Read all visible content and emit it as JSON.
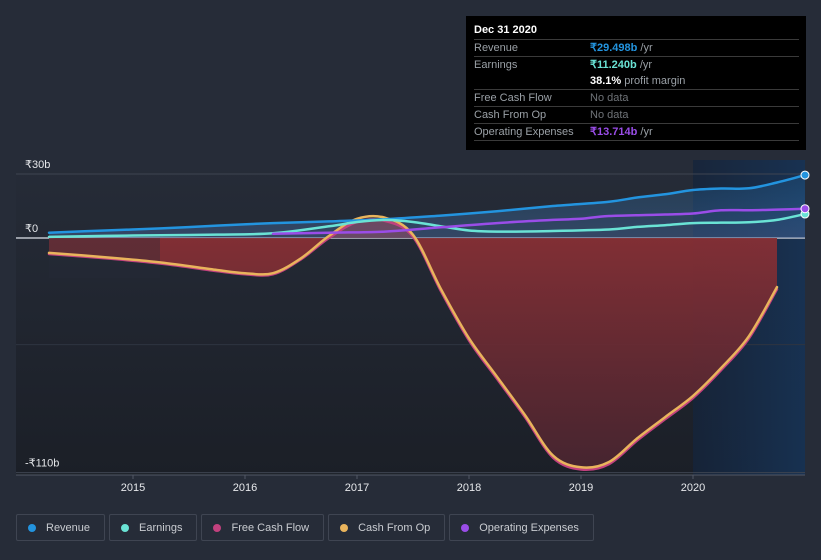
{
  "chart_data": {
    "type": "line",
    "title": "",
    "xlabel": "",
    "ylabel": "",
    "currency_symbol": "₹",
    "y_ticks": [
      {
        "value": 30,
        "label": "₹30b"
      },
      {
        "value": 0,
        "label": "₹0"
      },
      {
        "value": -110,
        "label": "-₹110b"
      }
    ],
    "x_ticks": [
      {
        "value": 2015,
        "label": "2015"
      },
      {
        "value": 2016,
        "label": "2016"
      },
      {
        "value": 2017,
        "label": "2017"
      },
      {
        "value": 2018,
        "label": "2018"
      },
      {
        "value": 2019,
        "label": "2019"
      },
      {
        "value": 2020,
        "label": "2020"
      }
    ],
    "xlim": [
      2014.25,
      2021.0
    ],
    "ylim": [
      -110,
      30
    ],
    "highlight_start": 2020.0,
    "series": [
      {
        "name": "Revenue",
        "key": "revenue",
        "color": "#2394df",
        "unit": "b",
        "x": [
          2014.25,
          2014.75,
          2015.25,
          2015.75,
          2016.25,
          2016.75,
          2017.25,
          2017.75,
          2018.25,
          2018.75,
          2019.25,
          2019.5,
          2019.75,
          2020.0,
          2020.25,
          2020.5,
          2020.75,
          2021.0
        ],
        "values": [
          2.5,
          3.5,
          4.5,
          5.8,
          7.0,
          7.8,
          8.8,
          10.5,
          12.5,
          15.0,
          17.0,
          19.0,
          20.5,
          22.5,
          23.2,
          23.3,
          26.0,
          29.5
        ]
      },
      {
        "name": "Earnings",
        "key": "earnings",
        "color": "#6ae3d5",
        "unit": "b",
        "x": [
          2014.25,
          2014.75,
          2015.25,
          2015.75,
          2016.25,
          2016.75,
          2017.0,
          2017.25,
          2017.5,
          2017.75,
          2018.0,
          2018.25,
          2018.75,
          2019.25,
          2019.5,
          2019.75,
          2020.0,
          2020.25,
          2020.5,
          2020.75,
          2021.0
        ],
        "values": [
          0.5,
          1.0,
          1.3,
          1.6,
          2.2,
          5.5,
          7.5,
          8.5,
          7.5,
          5.5,
          3.5,
          3.0,
          3.3,
          4.0,
          5.2,
          6.0,
          7.0,
          7.2,
          7.4,
          8.5,
          11.24
        ]
      },
      {
        "name": "Free Cash Flow",
        "key": "fcf",
        "color": "#c2417e",
        "unit": "b",
        "x": [
          2014.25,
          2014.75,
          2015.25,
          2015.75,
          2016.0,
          2016.25,
          2016.5,
          2016.75,
          2017.0,
          2017.25,
          2017.5,
          2017.75,
          2018.0,
          2018.25,
          2018.5,
          2018.75,
          2019.0,
          2019.25,
          2019.5,
          2019.75,
          2020.0,
          2020.25,
          2020.5,
          2020.75
        ],
        "values": [
          -7.5,
          -9.5,
          -12.0,
          -15.5,
          -17.0,
          -17.0,
          -10.0,
          0.0,
          7.5,
          8.0,
          0.5,
          -25.0,
          -48.0,
          -66.0,
          -84.0,
          -103.0,
          -108.5,
          -106.0,
          -95.0,
          -85.0,
          -75.0,
          -62.0,
          -47.0,
          -24.0
        ]
      },
      {
        "name": "Cash From Op",
        "key": "cfo",
        "color": "#e9b45c",
        "unit": "b",
        "x": [
          2014.25,
          2014.75,
          2015.25,
          2015.75,
          2016.0,
          2016.25,
          2016.5,
          2016.75,
          2017.0,
          2017.25,
          2017.5,
          2017.75,
          2018.0,
          2018.25,
          2018.5,
          2018.75,
          2019.0,
          2019.25,
          2019.5,
          2019.75,
          2020.0,
          2020.25,
          2020.5,
          2020.75
        ],
        "values": [
          -7.0,
          -9.0,
          -11.5,
          -15.0,
          -16.5,
          -16.5,
          -9.5,
          1.0,
          9.0,
          9.5,
          1.5,
          -24.0,
          -47.0,
          -65.0,
          -83.0,
          -102.0,
          -107.5,
          -105.0,
          -94.0,
          -84.0,
          -74.0,
          -61.0,
          -46.0,
          -23.0
        ]
      },
      {
        "name": "Operating Expenses",
        "key": "opex",
        "color": "#9a4de8",
        "unit": "b",
        "x": [
          2016.25,
          2016.75,
          2017.25,
          2017.75,
          2018.25,
          2018.75,
          2019.0,
          2019.25,
          2019.75,
          2020.0,
          2020.25,
          2020.5,
          2020.75,
          2021.0
        ],
        "values": [
          2.0,
          2.5,
          3.0,
          5.0,
          7.0,
          8.5,
          9.0,
          10.3,
          11.0,
          11.5,
          13.0,
          13.0,
          13.3,
          13.714
        ]
      }
    ]
  },
  "tooltip": {
    "date": "Dec 31 2020",
    "rows": [
      {
        "label": "Revenue",
        "value": "₹29.498b",
        "suffix": " /yr",
        "color": "#2394df"
      },
      {
        "label": "Earnings",
        "value": "₹11.240b",
        "suffix": " /yr",
        "color": "#6ae3d5"
      },
      {
        "label": "",
        "value": "38.1%",
        "suffix": " profit margin",
        "color": "#ffffff"
      },
      {
        "label": "Free Cash Flow",
        "value": "No data",
        "suffix": "",
        "color": "#6f7378"
      },
      {
        "label": "Cash From Op",
        "value": "No data",
        "suffix": "",
        "color": "#6f7378"
      },
      {
        "label": "Operating Expenses",
        "value": "₹13.714b",
        "suffix": " /yr",
        "color": "#9a4de8"
      }
    ]
  },
  "legend": [
    {
      "label": "Revenue",
      "color": "#2394df"
    },
    {
      "label": "Earnings",
      "color": "#6ae3d5"
    },
    {
      "label": "Free Cash Flow",
      "color": "#c2417e"
    },
    {
      "label": "Cash From Op",
      "color": "#e9b45c"
    },
    {
      "label": "Operating Expenses",
      "color": "#9a4de8"
    }
  ]
}
